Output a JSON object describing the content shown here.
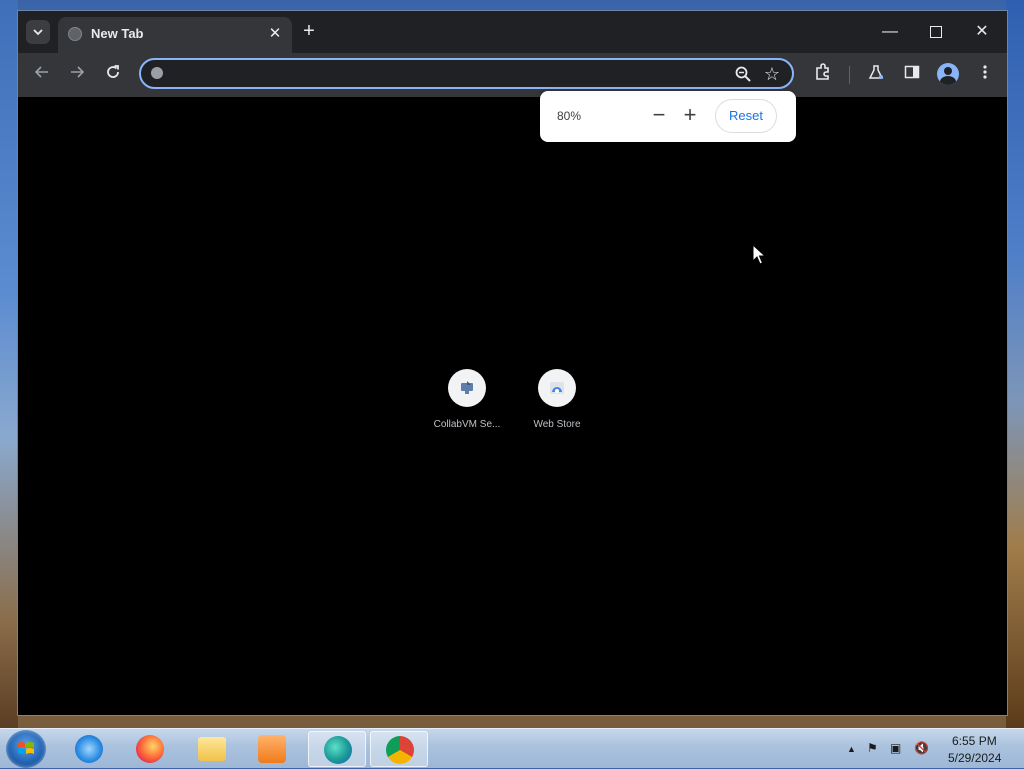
{
  "browser": {
    "tab": {
      "title": "New Tab"
    },
    "omnibox": {
      "value": "",
      "placeholder": ""
    },
    "window_controls": {
      "minimize": "—",
      "close": "✕"
    }
  },
  "zoom_bubble": {
    "percent": "80%",
    "minus_label": "−",
    "plus_label": "+",
    "reset_label": "Reset"
  },
  "shortcuts": [
    {
      "label": "CollabVM Se...",
      "icon": "collabvm-icon"
    },
    {
      "label": "Web Store",
      "icon": "web-store-icon"
    }
  ],
  "taskbar": {
    "apps": [
      {
        "name": "internet-explorer",
        "icon": "ie-icon"
      },
      {
        "name": "firefox",
        "icon": "firefox-icon"
      },
      {
        "name": "file-explorer",
        "icon": "folder-icon"
      },
      {
        "name": "media-player",
        "icon": "media-player-icon"
      },
      {
        "name": "edge",
        "icon": "edge-icon",
        "active": true
      },
      {
        "name": "chrome",
        "icon": "chrome-icon",
        "active": true
      }
    ],
    "clock": {
      "time": "6:55 PM",
      "date": "5/29/2024"
    }
  },
  "colors": {
    "accent": "#8ab4f8",
    "reset_text": "#1a73e8",
    "page_background": "#000000"
  }
}
